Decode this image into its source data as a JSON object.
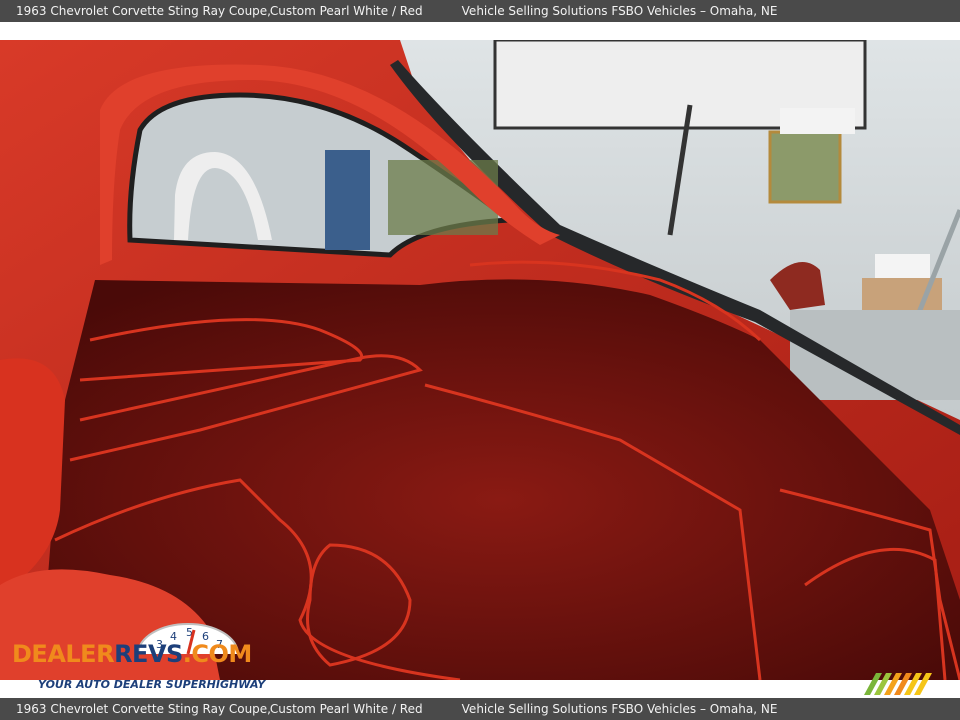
{
  "header": {
    "vehicle": "1963 Chevrolet Corvette Sting Ray Coupe,",
    "color": "Custom Pearl White / Red",
    "dealer": "Vehicle Selling Solutions FSBO Vehicles – Omaha, NE"
  },
  "footer": {
    "vehicle": "1963 Chevrolet Corvette Sting Ray Coupe,",
    "color": "Custom Pearl White / Red",
    "dealer": "Vehicle Selling Solutions FSBO Vehicles – Omaha, NE"
  },
  "watermark": {
    "brand_part1": "DEALER",
    "brand_part2": "REVS",
    "brand_part3": ".COM",
    "tagline": "YOUR AUTO DEALER SUPERHIGHWAY",
    "dial_digits": [
      "3",
      "4",
      "5",
      "6",
      "7"
    ]
  },
  "colors": {
    "bar_bg": "#4a4a4a",
    "interior_red": "#c9261b",
    "carpet_red": "#7a1410",
    "logo_orange": "#f08a1c",
    "logo_blue": "#1d3f7a"
  }
}
